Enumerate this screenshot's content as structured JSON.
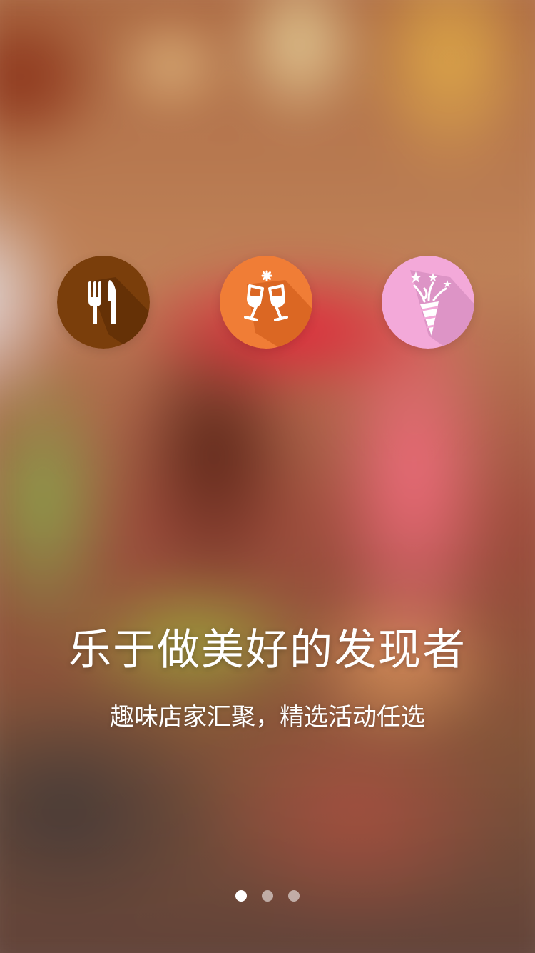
{
  "features": [
    {
      "icon": "fork-knife-icon",
      "color": "#7a3e0b"
    },
    {
      "icon": "champagne-toast-icon",
      "color": "#f07d36"
    },
    {
      "icon": "party-popper-icon",
      "color": "#f3a9d9"
    }
  ],
  "headline": "乐于做美好的发现者",
  "subline": "趣味店家汇聚，精选活动任选",
  "pager": {
    "total": 3,
    "current": 1
  },
  "colors": {
    "text": "#ffffff",
    "dot_active": "#ffffff"
  }
}
